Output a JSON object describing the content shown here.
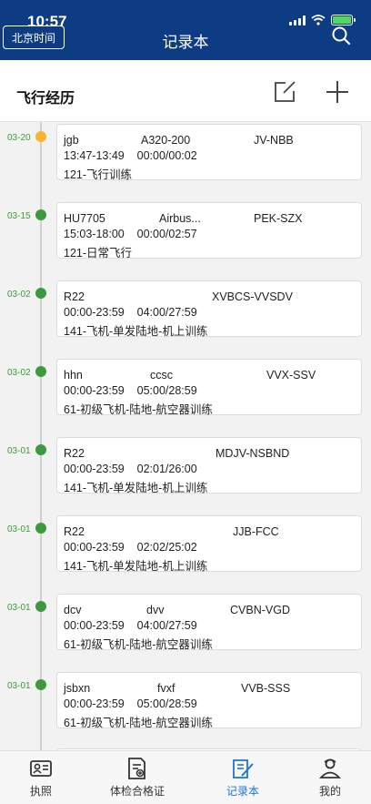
{
  "status_bar": {
    "time": "10:57"
  },
  "header": {
    "title": "记录本",
    "beijing_time_label": "北京时间"
  },
  "section": {
    "title": "飞行经历"
  },
  "entries": [
    {
      "date": "03-20",
      "flight": "jgb",
      "aircraft": "A320-200",
      "registration": "JV-NBB",
      "time_range": "13:47-13:49",
      "duration": "00:00/00:02",
      "category": "121-飞行训练",
      "dot_status": "pending"
    },
    {
      "date": "03-15",
      "flight": "HU7705",
      "aircraft": "Airbus...",
      "registration": "PEK-SZX",
      "time_range": "15:03-18:00",
      "duration": "00:00/02:57",
      "category": "121-日常飞行",
      "dot_status": "done"
    },
    {
      "date": "03-02",
      "flight": "R22",
      "aircraft": "",
      "registration": "XVBCS-VVSDV",
      "time_range": "00:00-23:59",
      "duration": "04:00/27:59",
      "category": "141-飞机-单发陆地-机上训练",
      "dot_status": "done"
    },
    {
      "date": "03-02",
      "flight": "hhn",
      "aircraft": "ccsc",
      "registration": "VVX-SSV",
      "time_range": "00:00-23:59",
      "duration": "05:00/28:59",
      "category": "61-初级飞机-陆地-航空器训练",
      "dot_status": "done"
    },
    {
      "date": "03-01",
      "flight": "R22",
      "aircraft": "",
      "registration": "MDJV-NSBND",
      "time_range": "00:00-23:59",
      "duration": "02:01/26:00",
      "category": "141-飞机-单发陆地-机上训练",
      "dot_status": "done"
    },
    {
      "date": "03-01",
      "flight": "R22",
      "aircraft": "",
      "registration": "JJB-FCC",
      "time_range": "00:00-23:59",
      "duration": "02:02/25:02",
      "category": "141-飞机-单发陆地-机上训练",
      "dot_status": "done"
    },
    {
      "date": "03-01",
      "flight": "dcv",
      "aircraft": "dvv",
      "registration": "CVBN-VGD",
      "time_range": "00:00-23:59",
      "duration": "04:00/27:59",
      "category": "61-初级飞机-陆地-航空器训练",
      "dot_status": "done"
    },
    {
      "date": "03-01",
      "flight": "jsbxn",
      "aircraft": "fvxf",
      "registration": "VVB-SSS",
      "time_range": "00:00-23:59",
      "duration": "05:00/28:59",
      "category": "61-初级飞机-陆地-航空器训练",
      "dot_status": "done"
    }
  ],
  "bottom_nav": {
    "items": [
      {
        "label": "执照",
        "icon": "license-icon"
      },
      {
        "label": "体检合格证",
        "icon": "medical-certificate-icon"
      },
      {
        "label": "记录本",
        "icon": "logbook-icon",
        "active": true
      },
      {
        "label": "我的",
        "icon": "profile-icon"
      }
    ]
  },
  "colors": {
    "header_bg": "#0e3c82",
    "timeline_green": "#3c9a3c",
    "pending_yellow": "#f5b530",
    "active_tab": "#1e74d8"
  }
}
